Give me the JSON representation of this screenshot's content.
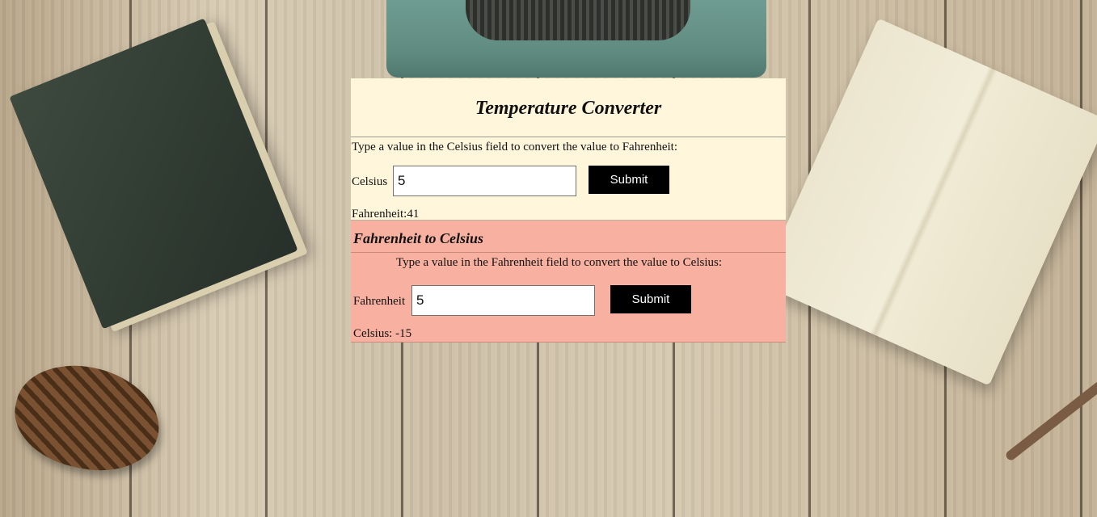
{
  "converter": {
    "title": "Temperature Converter",
    "celsius_section": {
      "instruction": "Type a value in the Celsius field to convert the value to Fahrenheit:",
      "input_label": "Celsius",
      "input_value": "5",
      "submit_label": "Submit",
      "result_text": "Fahrenheit:41"
    },
    "fahrenheit_section": {
      "heading": "Fahrenheit to Celsius",
      "instruction": "Type a value in the Fahrenheit field to convert the value to Celsius:",
      "input_label": "Fahrenheit",
      "input_value": "5",
      "submit_label": "Submit",
      "result_text": "Celsius: -15"
    }
  },
  "colors": {
    "top_panel_bg": "#fff6db",
    "bottom_panel_bg": "#f8b1a0",
    "button_bg": "#000000",
    "button_text": "#ffffff"
  },
  "background_scene": [
    "wood-plank-table",
    "typewriter",
    "closed-book",
    "open-notebook",
    "pinecone",
    "twig"
  ]
}
